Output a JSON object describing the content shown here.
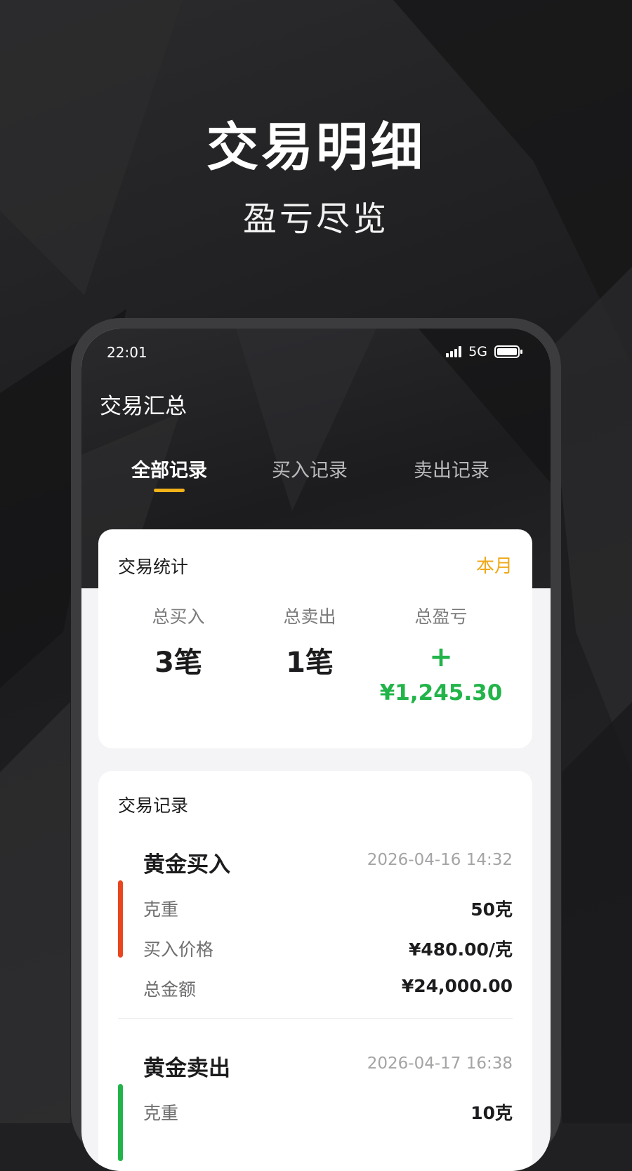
{
  "hero": {
    "title": "交易明细",
    "subtitle": "盈亏尽览"
  },
  "status_bar": {
    "time": "22:01",
    "network": "5G",
    "icons": [
      "signal-bars-icon",
      "battery-icon"
    ]
  },
  "header": {
    "title": "交易汇总"
  },
  "tabs": [
    {
      "label": "全部记录",
      "active": true
    },
    {
      "label": "买入记录",
      "active": false
    },
    {
      "label": "卖出记录",
      "active": false
    }
  ],
  "stats": {
    "title": "交易统计",
    "period": "本月",
    "buy": {
      "label": "总买入",
      "value": "3笔"
    },
    "sell": {
      "label": "总卖出",
      "value": "1笔"
    },
    "profit": {
      "label": "总盈亏",
      "sign": "+",
      "amount": "¥1,245.30"
    }
  },
  "records": {
    "title": "交易记录",
    "items": [
      {
        "type": "黄金买入",
        "time": "2026-04-16  14:32",
        "weight_label": "克重",
        "weight": "50克",
        "price_label": "买入价格",
        "price": "¥480.00/克",
        "total_label": "总金额",
        "total": "¥24,000.00"
      },
      {
        "type": "黄金卖出",
        "time": "2026-04-17  16:38",
        "weight_label": "克重",
        "weight": "10克"
      }
    ]
  },
  "colors": {
    "accent": "#f2b21a",
    "profit": "#22b449",
    "buy_marker": "#e8461e",
    "sell_marker": "#22b449"
  }
}
